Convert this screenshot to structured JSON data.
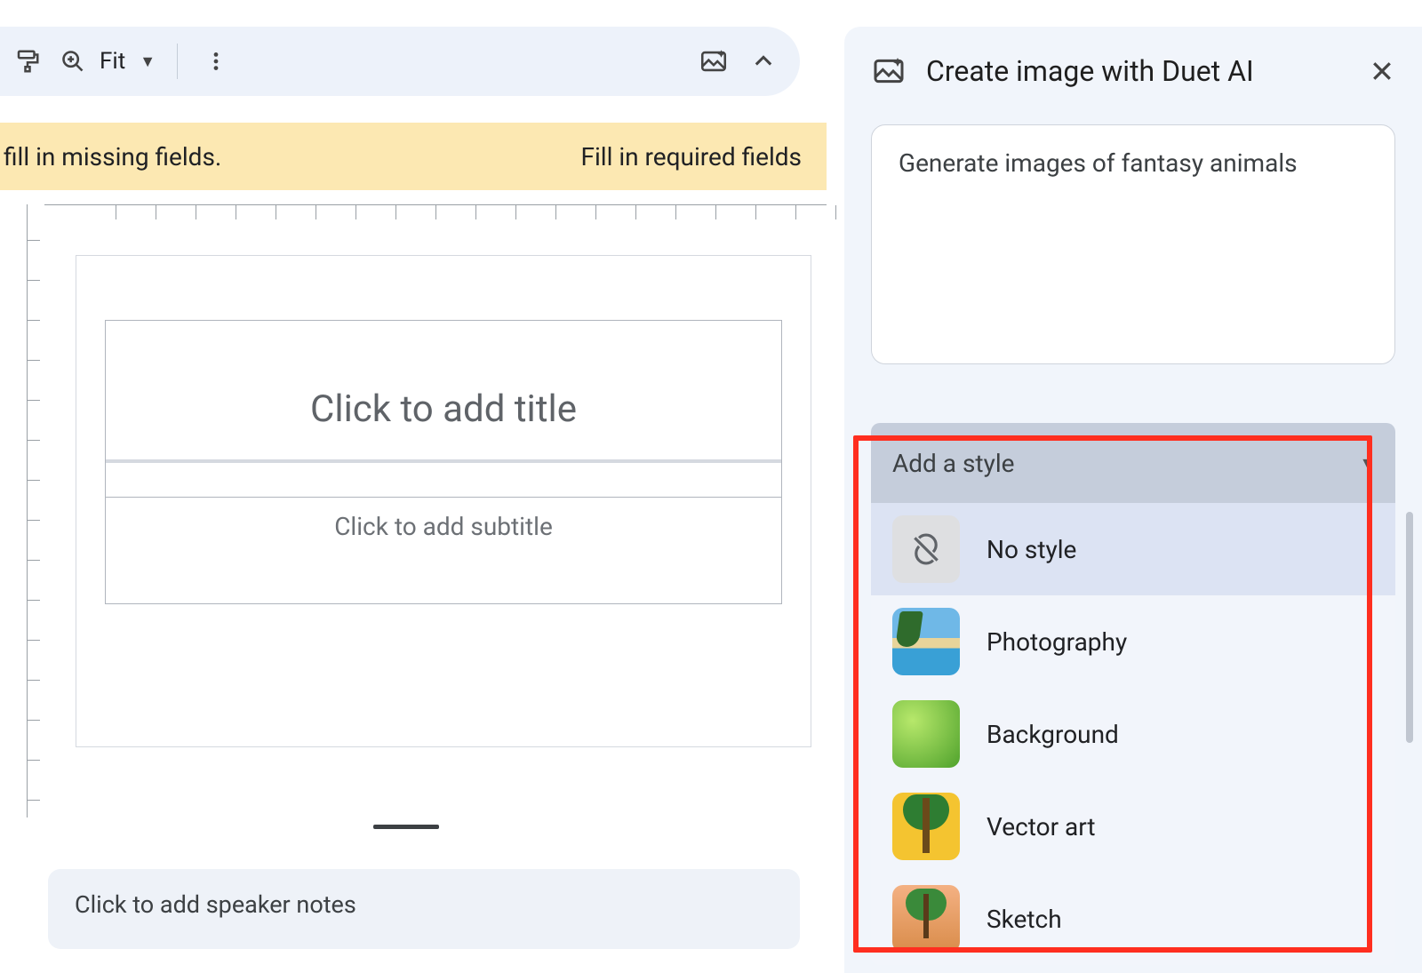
{
  "toolbar": {
    "zoom_label": "Fit"
  },
  "banner": {
    "left_text": "fill in missing fields.",
    "right_text": "Fill in required fields"
  },
  "slide": {
    "title_placeholder": "Click to add title",
    "subtitle_placeholder": "Click to add subtitle",
    "speaker_notes_placeholder": "Click to add speaker notes"
  },
  "sidepanel": {
    "title": "Create image with Duet AI",
    "prompt_text": "Generate images of fantasy animals",
    "style_header": "Add a style",
    "styles": [
      {
        "label": "No style"
      },
      {
        "label": "Photography"
      },
      {
        "label": "Background"
      },
      {
        "label": "Vector art"
      },
      {
        "label": "Sketch"
      }
    ]
  }
}
